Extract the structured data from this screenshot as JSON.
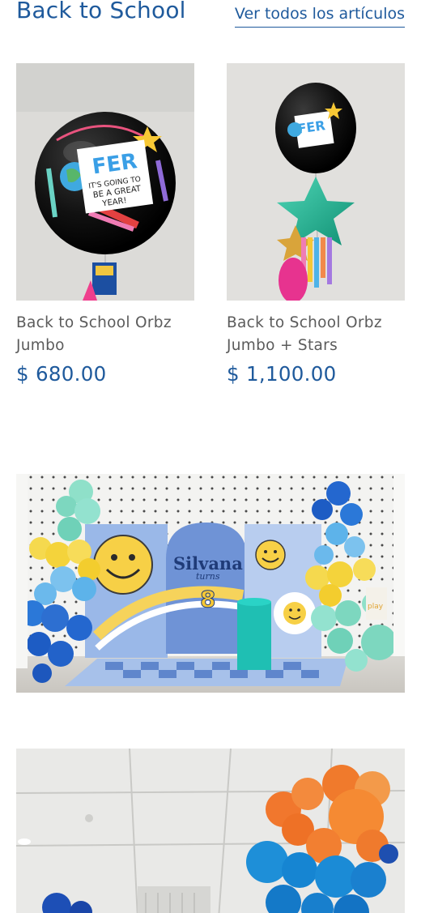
{
  "section": {
    "title": "Back to School",
    "view_all": "Ver todos los artículos"
  },
  "products": [
    {
      "name": "Back to School Orbz Jumbo",
      "price": "$ 680.00"
    },
    {
      "name": "Back to School Orbz Jumbo + Stars",
      "price": "$ 1,100.00"
    }
  ],
  "balloon_print": {
    "name": "FER",
    "line1": "IT'S GOING TO",
    "line2": "BE A GREAT",
    "line3": "YEAR!"
  },
  "backdrop": {
    "name": "Silvana",
    "subtitle": "turns",
    "age": "8",
    "sign": "play"
  },
  "colors": {
    "brand_blue": "#1f5a9c",
    "text_gray": "#5b5b5b"
  }
}
